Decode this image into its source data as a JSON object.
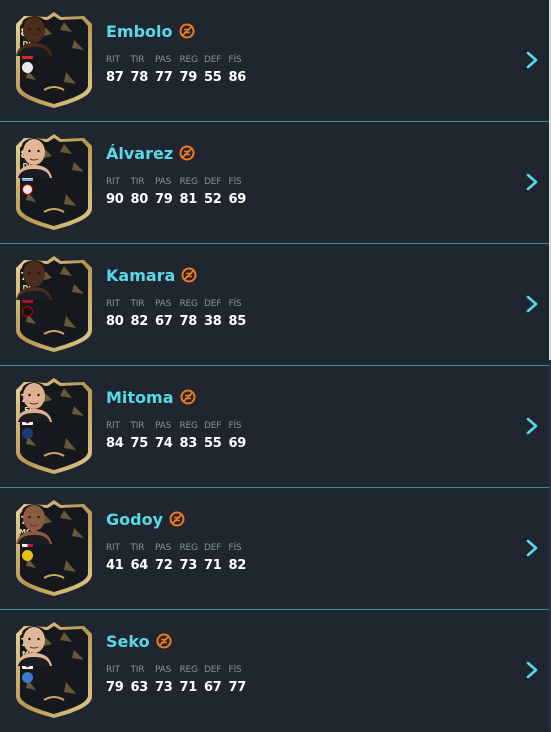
{
  "stat_labels": [
    "RIT",
    "TIR",
    "PAS",
    "REG",
    "DEF",
    "FÍS"
  ],
  "colors": {
    "name": "#58d9e8",
    "accent_badge": "#f07a1a",
    "chevron": "#58d9e8",
    "divider": "#3a8fa0",
    "background": "#1f2630"
  },
  "players": [
    {
      "name": "Embolo",
      "rating": "81",
      "position": "DC",
      "stats": [
        "87",
        "78",
        "77",
        "79",
        "55",
        "86"
      ],
      "flag": "switzerland-flag",
      "skin": "#4a2b1c"
    },
    {
      "name": "Álvarez",
      "rating": "81",
      "position": "DC",
      "stats": [
        "90",
        "80",
        "79",
        "81",
        "52",
        "69"
      ],
      "flag": "argentina-flag",
      "skin": "#e2b594"
    },
    {
      "name": "Kamara",
      "rating": "79",
      "position": "DC",
      "stats": [
        "80",
        "82",
        "67",
        "78",
        "38",
        "85"
      ],
      "flag": "norway-flag",
      "skin": "#4b2c1e"
    },
    {
      "name": "Mitoma",
      "rating": "79",
      "position": "EI",
      "stats": [
        "84",
        "75",
        "74",
        "83",
        "55",
        "69"
      ],
      "flag": "japan-flag",
      "skin": "#dcb090"
    },
    {
      "name": "Godoy",
      "rating": "78",
      "position": "MCD",
      "stats": [
        "41",
        "64",
        "72",
        "73",
        "71",
        "82"
      ],
      "flag": "panama-flag",
      "skin": "#8a5b40"
    },
    {
      "name": "Seko",
      "rating": "75",
      "position": "MC",
      "stats": [
        "79",
        "63",
        "73",
        "71",
        "67",
        "77"
      ],
      "flag": "japan-flag",
      "skin": "#e0b898"
    }
  ]
}
